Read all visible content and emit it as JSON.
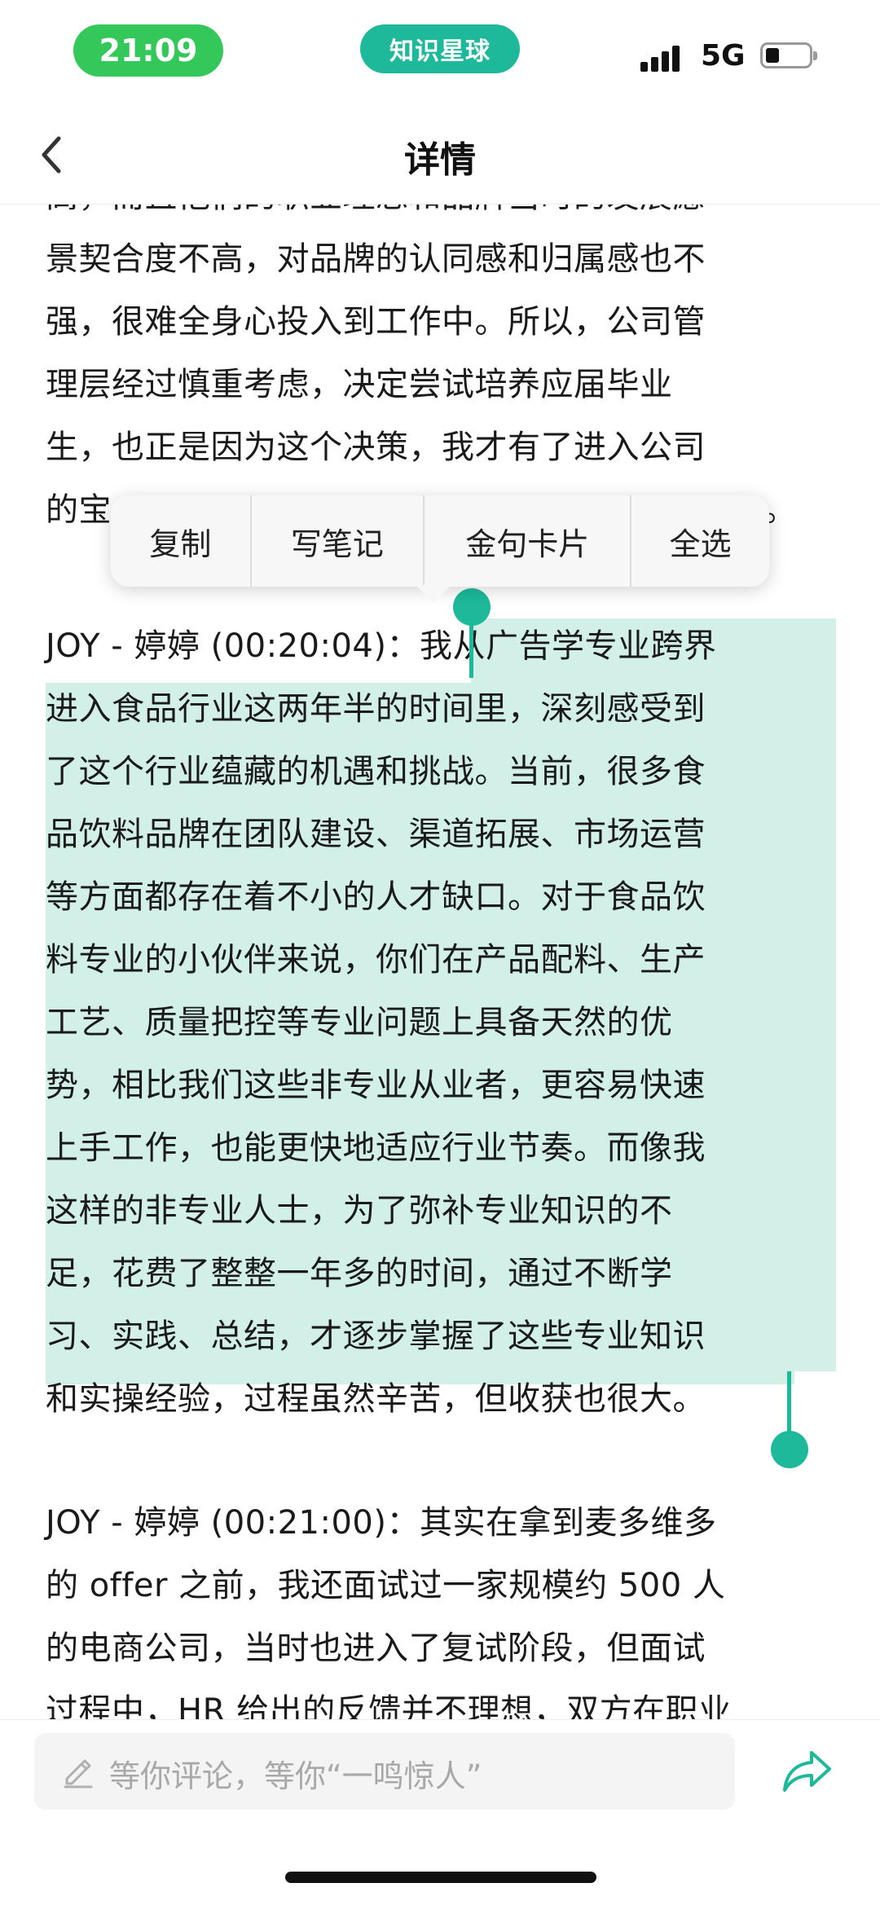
{
  "status_bar": {
    "time": "21:09",
    "app_badge": "知识星球",
    "network": "5G",
    "accent_green": "#34c759",
    "badge_teal": "#1db99a"
  },
  "nav": {
    "title": "详情",
    "back_icon": "chevron-left-icon"
  },
  "article": {
    "paragraphs": [
      {
        "lines": [
          "高，而且他们的职业理念和品牌当时的发展愿",
          "景契合度不高，对品牌的认同感和归属感也不",
          "强，很难全身心投入到工作中。所以，公司管",
          "理层经过慎重考虑，决定尝试培养应届毕业",
          "生，也正是因为这个决策，我才有了进入公司",
          "的宝"
        ],
        "trailing": "。"
      },
      {
        "speaker": "JOY - 婷婷 (00:20:04)：",
        "selected_lines": [
          "我从广告学专业跨界",
          "进入食品行业这两年半的时间里，深刻感受到",
          "了这个行业蕴藏的机遇和挑战。当前，很多食",
          "品饮料品牌在团队建设、渠道拓展、市场运营",
          "等方面都存在着不小的人才缺口。对于食品饮",
          "料专业的小伙伴来说，你们在产品配料、生产",
          "工艺、质量把控等专业问题上具备天然的优",
          "势，相比我们这些非专业从业者，更容易快速",
          "上手工作，也能更快地适应行业节奏。而像我",
          "这样的非专业人士，为了弥补专业知识的不",
          "足，花费了整整一年多的时间，通过不断学",
          "习、实践、总结，才逐步掌握了这些专业知识",
          "和实操经验，过程虽然辛苦，但收获也很大。"
        ],
        "selection_color": "#d2f0e8"
      },
      {
        "lines": [
          "JOY - 婷婷 (00:21:00)：其实在拿到麦多维多",
          "的 offer 之前，我还面试过一家规模约 500 人",
          "的电商公司，当时也进入了复试阶段，但面试",
          "过程中，HR 给出的反馈并不理想，双方在职业"
        ]
      }
    ]
  },
  "context_menu": {
    "items": [
      {
        "label": "复制"
      },
      {
        "label": "写笔记"
      },
      {
        "label": "金句卡片"
      },
      {
        "label": "全选"
      }
    ]
  },
  "bottom_bar": {
    "placeholder": "等你评论，等你“一鸣惊人”",
    "pen_icon": "pen-icon",
    "share_icon": "share-icon"
  }
}
